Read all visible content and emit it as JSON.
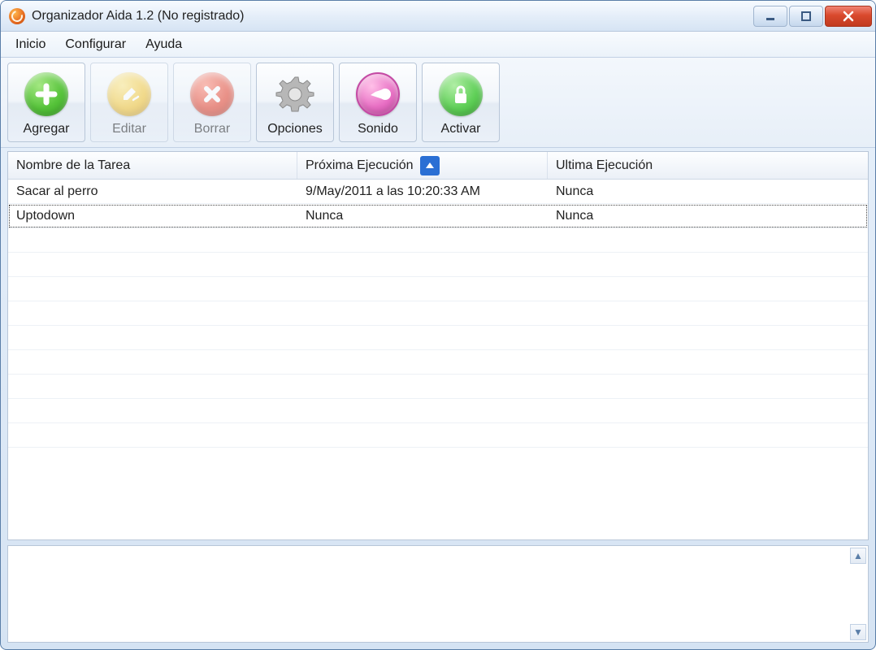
{
  "window": {
    "title": "Organizador Aida 1.2 (No registrado)"
  },
  "menubar": {
    "items": [
      {
        "label": "Inicio"
      },
      {
        "label": "Configurar"
      },
      {
        "label": "Ayuda"
      }
    ]
  },
  "toolbar": {
    "buttons": [
      {
        "label": "Agregar",
        "icon": "plus",
        "enabled": true
      },
      {
        "label": "Editar",
        "icon": "pencil",
        "enabled": false
      },
      {
        "label": "Borrar",
        "icon": "cross",
        "enabled": false
      },
      {
        "label": "Opciones",
        "icon": "gear",
        "enabled": true
      },
      {
        "label": "Sonido",
        "icon": "megaphone",
        "enabled": true
      },
      {
        "label": "Activar",
        "icon": "lock",
        "enabled": true
      }
    ]
  },
  "table": {
    "columns": [
      {
        "label": "Nombre de la Tarea"
      },
      {
        "label": "Próxima Ejecución",
        "sorted": true
      },
      {
        "label": "Ultima Ejecución"
      }
    ],
    "rows": [
      {
        "name": "Sacar al perro",
        "next": "9/May/2011 a las 10:20:33 AM",
        "last": "Nunca",
        "selected": false
      },
      {
        "name": "Uptodown",
        "next": "Nunca",
        "last": "Nunca",
        "selected": true
      }
    ]
  }
}
